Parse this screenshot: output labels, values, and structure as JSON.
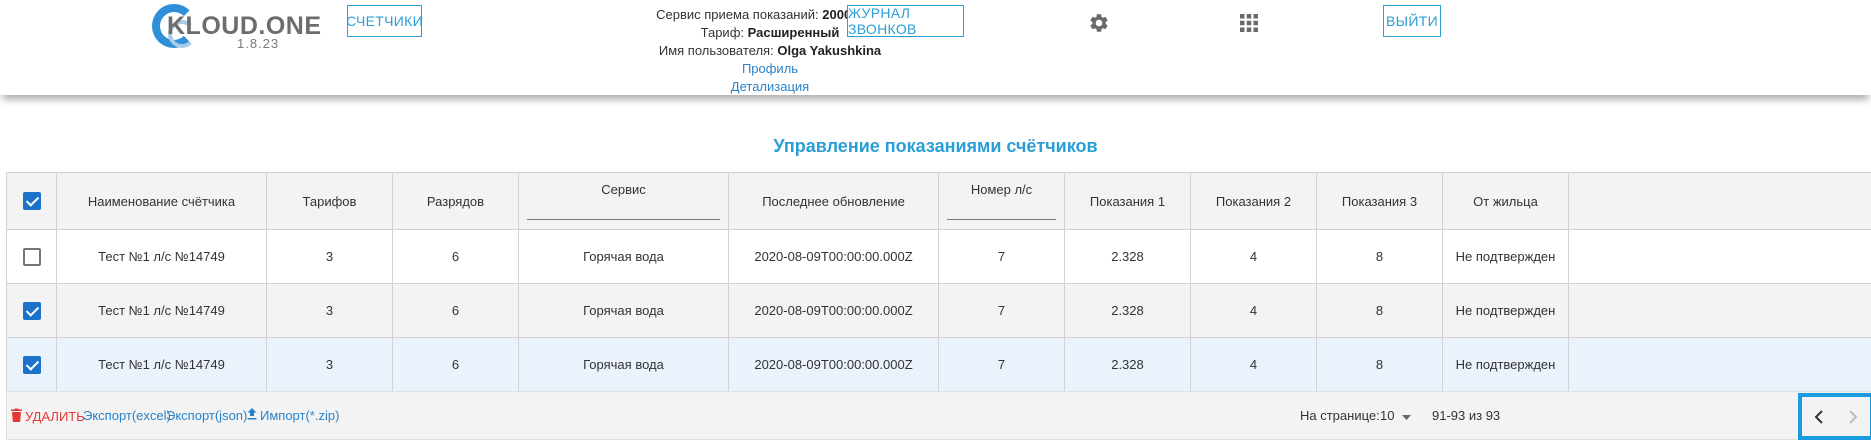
{
  "header": {
    "logo_text": "KLOUD.ONE",
    "logo_version": "1.8.23",
    "btn_counters": "СЧЕТЧИКИ",
    "btn_calls": "ЖУРНАЛ ЗВОНКОВ",
    "btn_logout": "ВЫЙТИ",
    "service_label": "Сервис приема показаний:",
    "service_value": "2000 мин.",
    "tariff_label": "Тариф:",
    "tariff_value": "Расширенный",
    "user_label": "Имя пользователя:",
    "user_value": "Olga Yakushkina",
    "link_profile": "Профиль",
    "link_details": "Детализация",
    "icons": [
      "gear-icon",
      "apps-grid-icon"
    ]
  },
  "page": {
    "title": "Управление показаниями счётчиков"
  },
  "table": {
    "headers": {
      "name": "Наименование счётчика",
      "tariffs": "Тарифов",
      "digits": "Разрядов",
      "service": "Сервис",
      "updated": "Последнее обновление",
      "account": "Номер л/с",
      "reading1": "Показания 1",
      "reading2": "Показания 2",
      "reading3": "Показания 3",
      "from_tenant": "От жильца"
    },
    "header_checked": true,
    "rows": [
      {
        "checked": false,
        "name": "Тест №1 л/с №14749",
        "tariffs": "3",
        "digits": "6",
        "service": "Горячая вода",
        "updated": "2020-08-09T00:00:00.000Z",
        "account": "7",
        "reading1": "2.328",
        "reading2": "4",
        "reading3": "8",
        "from_tenant": "Не подтвержден"
      },
      {
        "checked": true,
        "name": "Тест №1 л/с №14749",
        "tariffs": "3",
        "digits": "6",
        "service": "Горячая вода",
        "updated": "2020-08-09T00:00:00.000Z",
        "account": "7",
        "reading1": "2.328",
        "reading2": "4",
        "reading3": "8",
        "from_tenant": "Не подтвержден"
      },
      {
        "checked": true,
        "name": "Тест №1 л/с №14749",
        "tariffs": "3",
        "digits": "6",
        "service": "Горячая вода",
        "updated": "2020-08-09T00:00:00.000Z",
        "account": "7",
        "reading1": "2.328",
        "reading2": "4",
        "reading3": "8",
        "from_tenant": "Не подтвержден"
      }
    ]
  },
  "footer": {
    "delete_label": "УДАЛИТЬ",
    "export_excel": "Экспорт(excel)",
    "export_json": "Экспорт(json)",
    "import_zip": "Импорт(*.zip)",
    "per_page_label": "На странице:",
    "per_page_value": "10",
    "range_text": "91-93 из 93"
  },
  "colors": {
    "accent": "#2a9fd6",
    "link": "#2a83c9",
    "danger": "#e53935",
    "checkbox": "#1a73c9",
    "nav_highlight": "#1a9be0"
  }
}
